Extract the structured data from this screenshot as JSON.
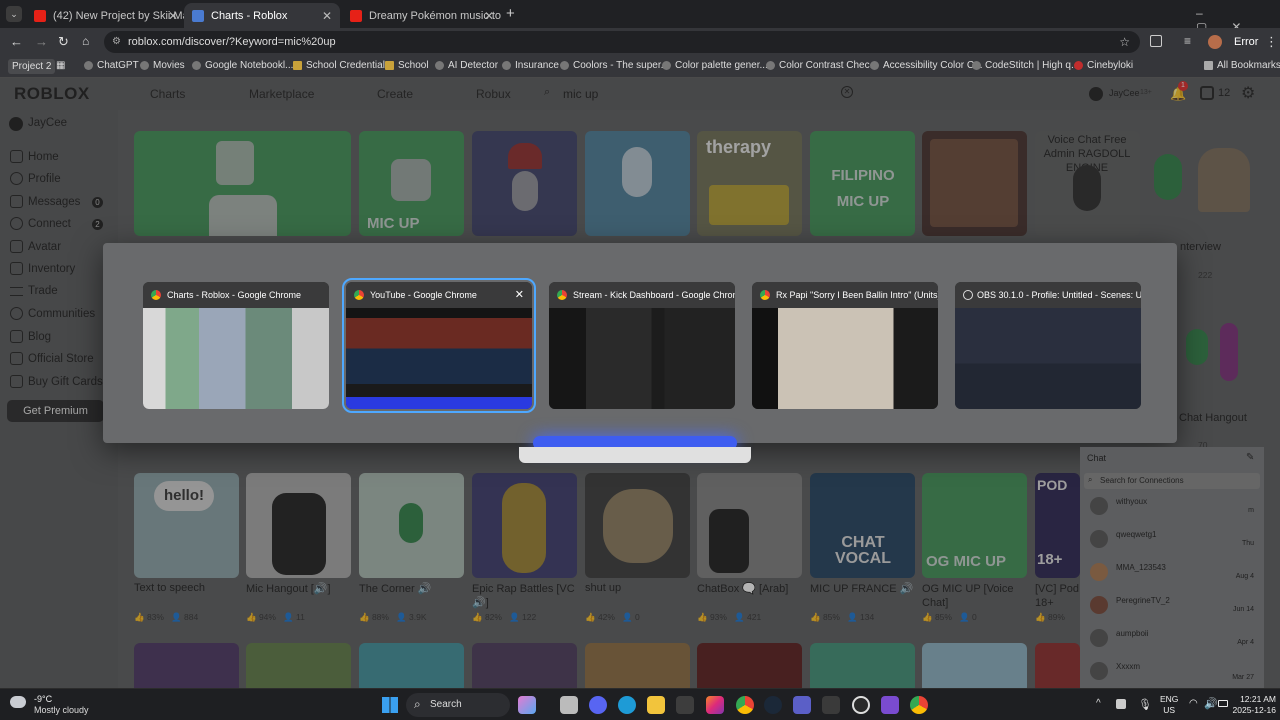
{
  "tabs": [
    {
      "title": "(42) New Project by Skii Mask |",
      "icon": "youtube-icon"
    },
    {
      "title": "Charts - Roblox",
      "icon": "roblox-icon"
    },
    {
      "title": "Dreamy Pokémon music to rel",
      "icon": "youtube-icon"
    }
  ],
  "address": {
    "url": "roblox.com/discover/?Keyword=mic%20up",
    "profile_label": "Error"
  },
  "bookmarks": [
    "Project 2",
    "ChatGPT",
    "Movies",
    "Google Notebookl...",
    "School Credentials",
    "School",
    "AI Detector",
    "Insurance",
    "Coolors - The super...",
    "Color palette gener...",
    "Color Contrast Chec...",
    "Accessibility Color C...",
    "CodeStitch | High q...",
    "Cinebyloki",
    "All Bookmarks"
  ],
  "roblox": {
    "logo": "ROBLOX",
    "nav": [
      "Charts",
      "Marketplace",
      "Create",
      "Robux"
    ],
    "search_value": "mic up",
    "user": "JayCee",
    "age": "13+",
    "notif_count": "1",
    "robux": "12"
  },
  "sidebar": {
    "user": "JayCee",
    "items": [
      {
        "label": "Home"
      },
      {
        "label": "Profile"
      },
      {
        "label": "Messages",
        "badge": "0"
      },
      {
        "label": "Connect",
        "badge": "2"
      },
      {
        "label": "Avatar"
      },
      {
        "label": "Inventory"
      },
      {
        "label": "Trade"
      },
      {
        "label": "Communities"
      },
      {
        "label": "Blog"
      },
      {
        "label": "Official Store"
      },
      {
        "label": "Buy Gift Cards"
      }
    ],
    "premium": "Get Premium"
  },
  "top_tiles": [
    "",
    "MIC UP",
    "",
    "",
    "therapy",
    "FILIPINO MIC UP",
    "",
    "Voice Chat Free Admin RAGDOLL ENGINE",
    ""
  ],
  "right_partial": {
    "name1": "nterview",
    "stat1": "222",
    "name2": "Chat Hangout",
    "stat2": "70"
  },
  "games": [
    {
      "name": "Text to speech",
      "like": "83%",
      "players": "884"
    },
    {
      "name": "Mic Hangout [🔊]",
      "like": "94%",
      "players": "11"
    },
    {
      "name": "The Corner 🔊",
      "like": "88%",
      "players": "3.9K"
    },
    {
      "name": "Epic Rap Battles [VC 🔊]",
      "like": "82%",
      "players": "122"
    },
    {
      "name": "shut up",
      "like": "42%",
      "players": "0"
    },
    {
      "name": "ChatBox 🗨️ [Arab]",
      "like": "93%",
      "players": "421"
    },
    {
      "name": "MIC UP FRANCE 🔊",
      "like": "85%",
      "players": "134"
    },
    {
      "name": "OG MIC UP [Voice Chat]",
      "like": "85%",
      "players": "0"
    },
    {
      "name": "[VC] Pod 18+",
      "like": "89%",
      "players": ""
    }
  ],
  "switcher": [
    {
      "title": "Charts - Roblox - Google Chrome",
      "selected": false
    },
    {
      "title": "YouTube - Google Chrome",
      "selected": true
    },
    {
      "title": "Stream - Kick Dashboard - Google Chrome",
      "selected": false
    },
    {
      "title": "Rx Papi \"Sorry I Been Ballin Intro\" (Units)...",
      "selected": false
    },
    {
      "title": "OBS 30.1.0 - Profile: Untitled - Scenes: Un...",
      "selected": false
    }
  ],
  "chat": {
    "title": "Chat",
    "search_placeholder": "Search for Connections",
    "contacts": [
      {
        "name": "withyoux",
        "time": "m"
      },
      {
        "name": "qweqwetg1",
        "time": "Thu"
      },
      {
        "name": "MMA_123543",
        "time": "Aug 4"
      },
      {
        "name": "PeregrineTV_2",
        "time": "Jun 14"
      },
      {
        "name": "aumpboii",
        "time": "Apr 4"
      },
      {
        "name": "Xxxxm",
        "time": "Mar 27"
      }
    ]
  },
  "taskbar": {
    "weather_temp": "-9°C",
    "weather_desc": "Mostly cloudy",
    "search": "Search",
    "lang1": "ENG",
    "lang2": "US",
    "time": "12:21 AM",
    "date": "2025-12-16"
  }
}
